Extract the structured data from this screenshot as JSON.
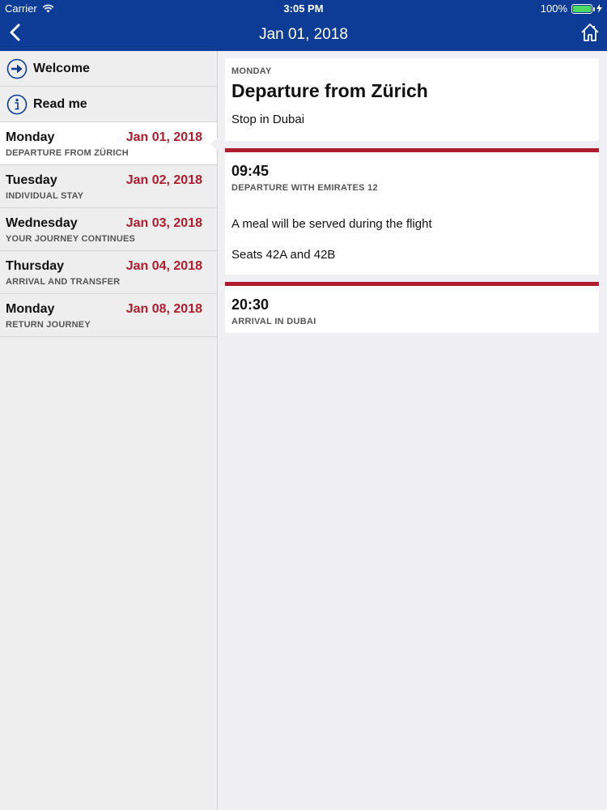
{
  "status_bar": {
    "carrier": "Carrier",
    "time": "3:05 PM",
    "battery": "100%",
    "battery_level": 1.0
  },
  "nav": {
    "title": "Jan 01, 2018",
    "back_icon": "chevron-left-icon",
    "home_icon": "home-icon"
  },
  "sidebar": {
    "links": [
      {
        "label": "Welcome",
        "icon": "arrow-right-circle-icon"
      },
      {
        "label": "Read me",
        "icon": "info-circle-icon"
      }
    ],
    "days": [
      {
        "day": "Monday",
        "date": "Jan 01, 2018",
        "subtitle": "DEPARTURE FROM ZÜRICH",
        "active": true
      },
      {
        "day": "Tuesday",
        "date": "Jan 02, 2018",
        "subtitle": "INDIVIDUAL STAY"
      },
      {
        "day": "Wednesday",
        "date": "Jan 03, 2018",
        "subtitle": "YOUR JOURNEY CONTINUES"
      },
      {
        "day": "Thursday",
        "date": "Jan 04, 2018",
        "subtitle": "ARRIVAL AND TRANSFER"
      },
      {
        "day": "Monday",
        "date": "Jan 08, 2018",
        "subtitle": "RETURN JOURNEY"
      }
    ]
  },
  "detail": {
    "weekday": "MONDAY",
    "title": "Departure from Zürich",
    "subtitle": "Stop in Dubai",
    "events": [
      {
        "time": "09:45",
        "description": "DEPARTURE WITH EMIRATES 12",
        "notes": [
          "A meal will be served during the flight",
          "Seats 42A and 42B"
        ]
      },
      {
        "time": "20:30",
        "description": "ARRIVAL IN DUBAI"
      }
    ]
  },
  "colors": {
    "nav_bg": "#0d3c96",
    "accent_red": "#b01c2e",
    "sidebar_bg": "#eeeeee",
    "content_bg": "#efeff4"
  }
}
